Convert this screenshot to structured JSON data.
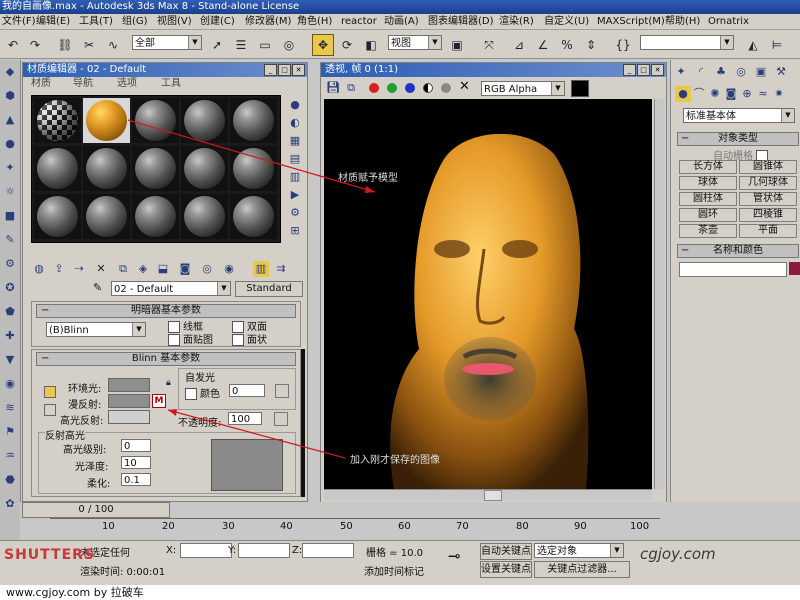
{
  "window": {
    "title": "我的自画像.max - Autodesk 3ds Max 8 - Stand-alone License"
  },
  "menu": [
    "文件(F)",
    "编辑(E)",
    "工具(T)",
    "组(G)",
    "视图(V)",
    "创建(C)",
    "修改器(M)",
    "角色(H)",
    "reactor",
    "动画(A)",
    "图表编辑器(D)",
    "渲染(R)",
    "自定义(U)",
    "MAXScript(M)",
    "帮助(H)",
    "Ornatrix"
  ],
  "toolbar": {
    "selection_filter": "全部",
    "ref_coord": "视图"
  },
  "material_editor": {
    "title": "材质编辑器 - 02 - Default",
    "menu": [
      "材质",
      "导航",
      "选项",
      "工具"
    ],
    "material_name": "02 - Default",
    "material_type": "Standard",
    "shader_basic_header": "明暗器基本参数",
    "shader_type": "(B)Blinn",
    "options": [
      "线框",
      "双面",
      "面贴图",
      "面状"
    ],
    "blinn_header": "Blinn 基本参数",
    "self_illum_label": "自发光",
    "color_label": "颜色",
    "color_value": "0",
    "ambient_label": "环境光:",
    "diffuse_label": "漫反射:",
    "specular_label": "高光反射:",
    "map_button": "M",
    "lock_icon": "lock-icon",
    "opacity_label": "不透明度:",
    "opacity_value": "100",
    "spec_header": "反射高光",
    "spec_level_label": "高光级别:",
    "spec_level_value": "0",
    "gloss_label": "光泽度:",
    "gloss_value": "10",
    "soften_label": "柔化:",
    "soften_value": "0.1"
  },
  "viewport": {
    "title": "透视, 帧 0 (1:1)",
    "channel": "RGB Alpha",
    "annotation_top": "材质赋予模型",
    "annotation_bottom": "加入刚才保存的图像"
  },
  "create_panel": {
    "category": "标准基本体",
    "object_type_header": "对象类型",
    "autogrid": "自动栅格",
    "buttons": [
      "长方体",
      "圆锥体",
      "球体",
      "几何球体",
      "圆柱体",
      "管状体",
      "圆环",
      "四棱锥",
      "茶壶",
      "平面"
    ],
    "name_color_header": "名称和颜色",
    "accent_color": "#8b1a3c"
  },
  "timeline": {
    "frame_display": "0 / 100",
    "ticks": [
      "10",
      "20",
      "30",
      "40",
      "50",
      "60",
      "70",
      "80",
      "90",
      "100"
    ]
  },
  "status": {
    "unselected": "未选定任何",
    "render_time": "渲染时间: 0:00:01",
    "x_label": "X:",
    "y_label": "Y:",
    "z_label": "Z:",
    "grid_label": "栅格 = 10.0",
    "auto_key": "自动关键点",
    "selected_object": "选定对象",
    "set_key": "设置关键点",
    "key_filters": "关键点过滤器...",
    "add_time_tag": "添加时间标记"
  },
  "footer": {
    "text": "www.cgjoy.com by 拉破车"
  },
  "logos": {
    "bottom_left": "SHUTTERS",
    "bottom_right": "cgjoy.com"
  }
}
